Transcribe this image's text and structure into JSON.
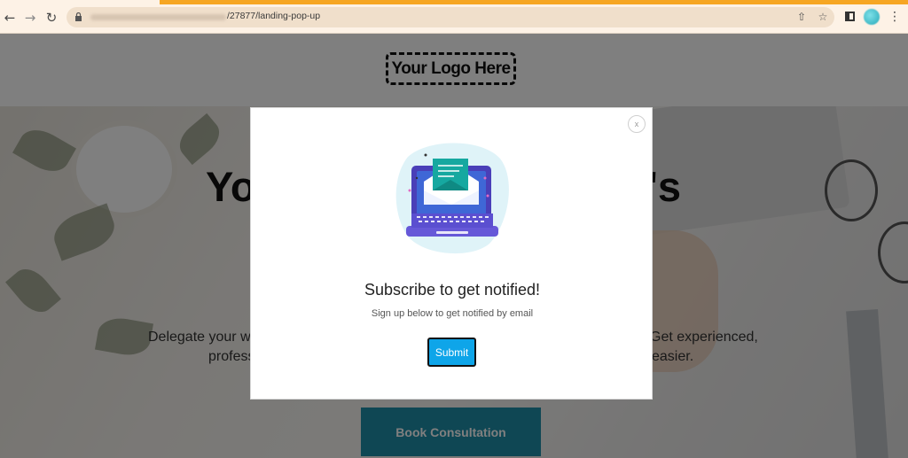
{
  "browser": {
    "url_path": "/27877/landing-pop-up",
    "icons": {
      "back": "arrow-left-icon",
      "forward": "arrow-right-icon",
      "reload": "reload-icon",
      "lock": "lock-icon",
      "share": "share-icon",
      "bookmark": "star-icon",
      "sidebar": "sidebar-icon",
      "menu": "menu-icon"
    },
    "accent_color": "#f6a623"
  },
  "header": {
    "logo_text": "Your Logo Here"
  },
  "hero": {
    "title_left": "Yo",
    "title_right": "t's",
    "desc_line1_left": "Delegate your w",
    "desc_line1_right": "Get experienced,",
    "desc_line2_left": "profess",
    "desc_line2_right": "easier.",
    "cta_label": "Book Consultation",
    "cta_color": "#1f8ea8"
  },
  "modal": {
    "close_label": "x",
    "illustration": "laptop-email-icon",
    "title": "Subscribe to get notified!",
    "subtitle": "Sign up below to get notified by email",
    "submit_label": "Submit",
    "submit_color": "#0ea5e9"
  }
}
